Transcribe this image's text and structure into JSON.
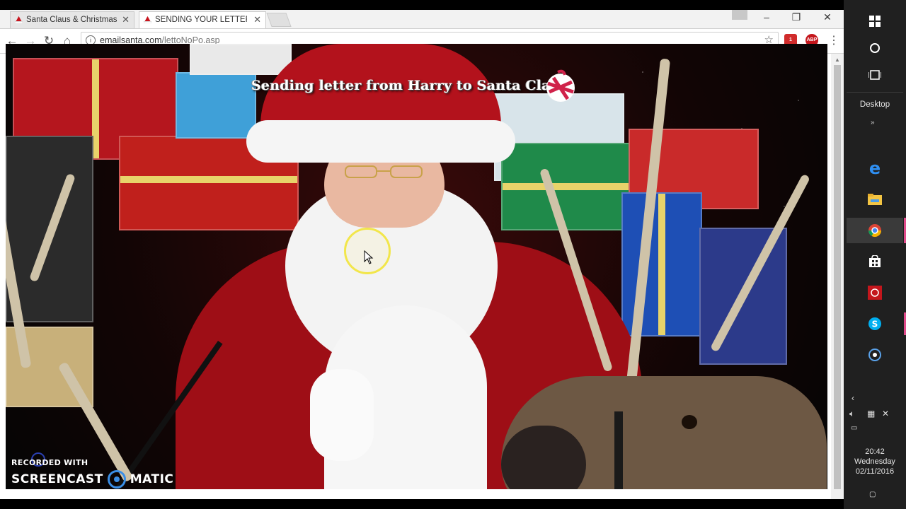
{
  "browser": {
    "tabs": [
      {
        "title": "Santa Claus & Christmas",
        "active": false
      },
      {
        "title": "SENDING YOUR LETTER",
        "active": true
      }
    ],
    "url_host": "emailsanta.com",
    "url_path": "/lettoNoPo.asp",
    "extension_badge": "1",
    "adblock_label": "ABP"
  },
  "page": {
    "title": "Sending letter from Harry to Santa Claus"
  },
  "watermark": {
    "line1": "RECORDED WITH",
    "brand_left": "SCREENCAST",
    "brand_right": "MATIC"
  },
  "taskbar": {
    "desktop_label": "Desktop",
    "time": "20:42",
    "day": "Wednesday",
    "date": "02/11/2016"
  },
  "colors": {
    "accent_cursor_ring": "#f2e64b",
    "taskbar_bg": "#202020",
    "santa_red": "#9e0e16"
  }
}
